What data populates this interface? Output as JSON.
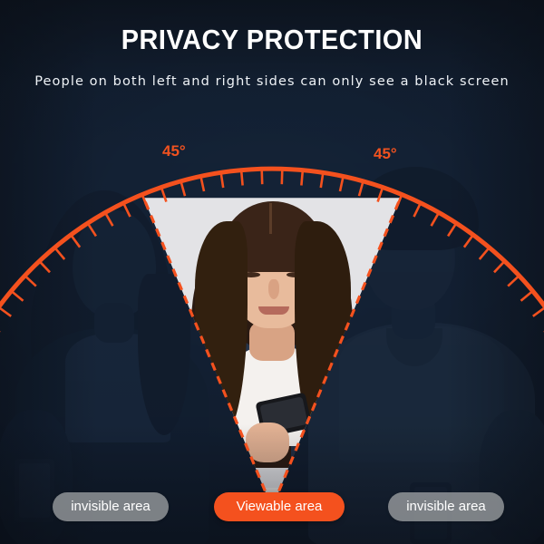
{
  "header": {
    "title": "PRIVACY PROTECTION",
    "subtitle": "People on both left and right sides can only see a black screen"
  },
  "gauge": {
    "angle_left_label": "45°",
    "angle_right_label": "45°",
    "arc_color": "#f4511e",
    "tick_count": 45,
    "cone_fill": "#e3e3e6",
    "cone_edge_style": "dashed",
    "total_view_angle_deg": 90,
    "half_angle_deg": 45
  },
  "legend": {
    "left": {
      "label": "invisible area",
      "style": "muted"
    },
    "center": {
      "label": "Viewable area",
      "style": "accent"
    },
    "right": {
      "label": "invisible area",
      "style": "muted"
    }
  },
  "people": {
    "left": {
      "name": "left-person",
      "state": "darkened"
    },
    "center": {
      "name": "center-person",
      "state": "bright"
    },
    "right": {
      "name": "right-person",
      "state": "darkened"
    }
  },
  "colors": {
    "background": "#1d2b3f",
    "accent": "#f4511e",
    "muted_pill": "#a8aaac",
    "text": "#ffffff"
  }
}
